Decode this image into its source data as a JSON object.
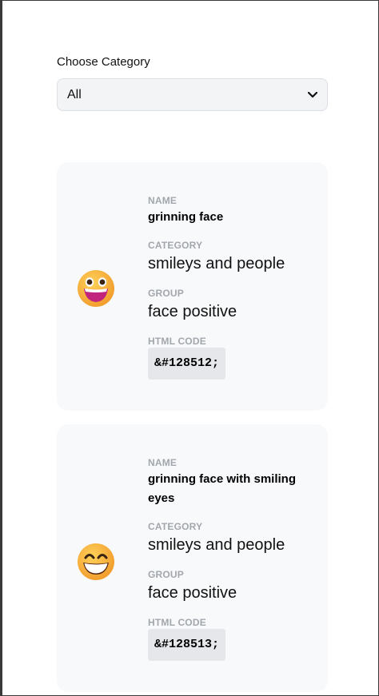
{
  "filter": {
    "label": "Choose Category",
    "selected": "All"
  },
  "labels": {
    "name": "NAME",
    "category": "CATEGORY",
    "group": "GROUP",
    "html_code": "HTML CODE"
  },
  "emojis": [
    {
      "icon": "grinning-face-icon",
      "name": "grinning face",
      "category": "smileys and people",
      "group": "face positive",
      "html_code": "&#128512;"
    },
    {
      "icon": "grinning-face-with-smiling-eyes-icon",
      "name_line1": "grinning face with smiling",
      "name_line2": "eyes",
      "category": "smileys and people",
      "group": "face positive",
      "html_code": "&#128513;"
    }
  ],
  "colors": {
    "emoji_yellow": "#F9B233",
    "emoji_orange": "#F08A2C",
    "card_bg": "#F8F9FA",
    "label_gray": "#A2A6AD"
  }
}
